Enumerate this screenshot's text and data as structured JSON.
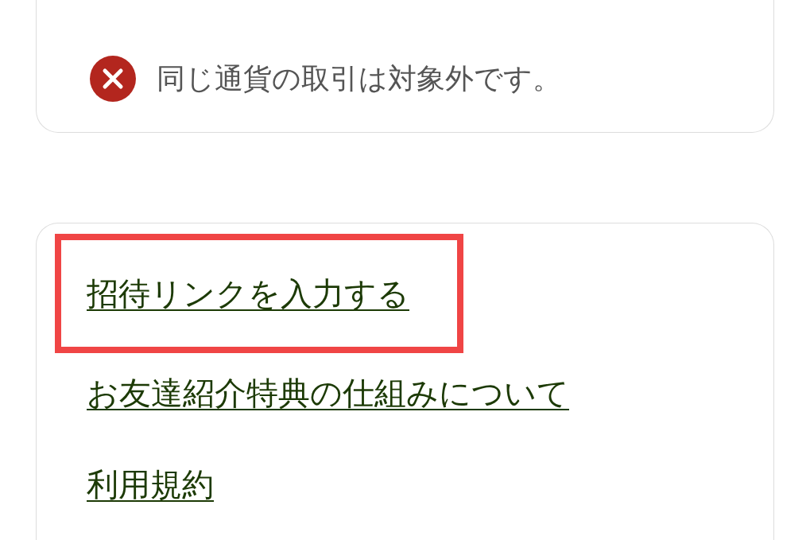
{
  "notice": {
    "kind": "error",
    "text": "同じ通貨の取引は対象外です。"
  },
  "links": [
    {
      "label": "招待リンクを入力する",
      "highlighted": true
    },
    {
      "label": "お友達紹介特典の仕組みについて",
      "highlighted": false
    },
    {
      "label": "利用規約",
      "highlighted": false
    }
  ]
}
